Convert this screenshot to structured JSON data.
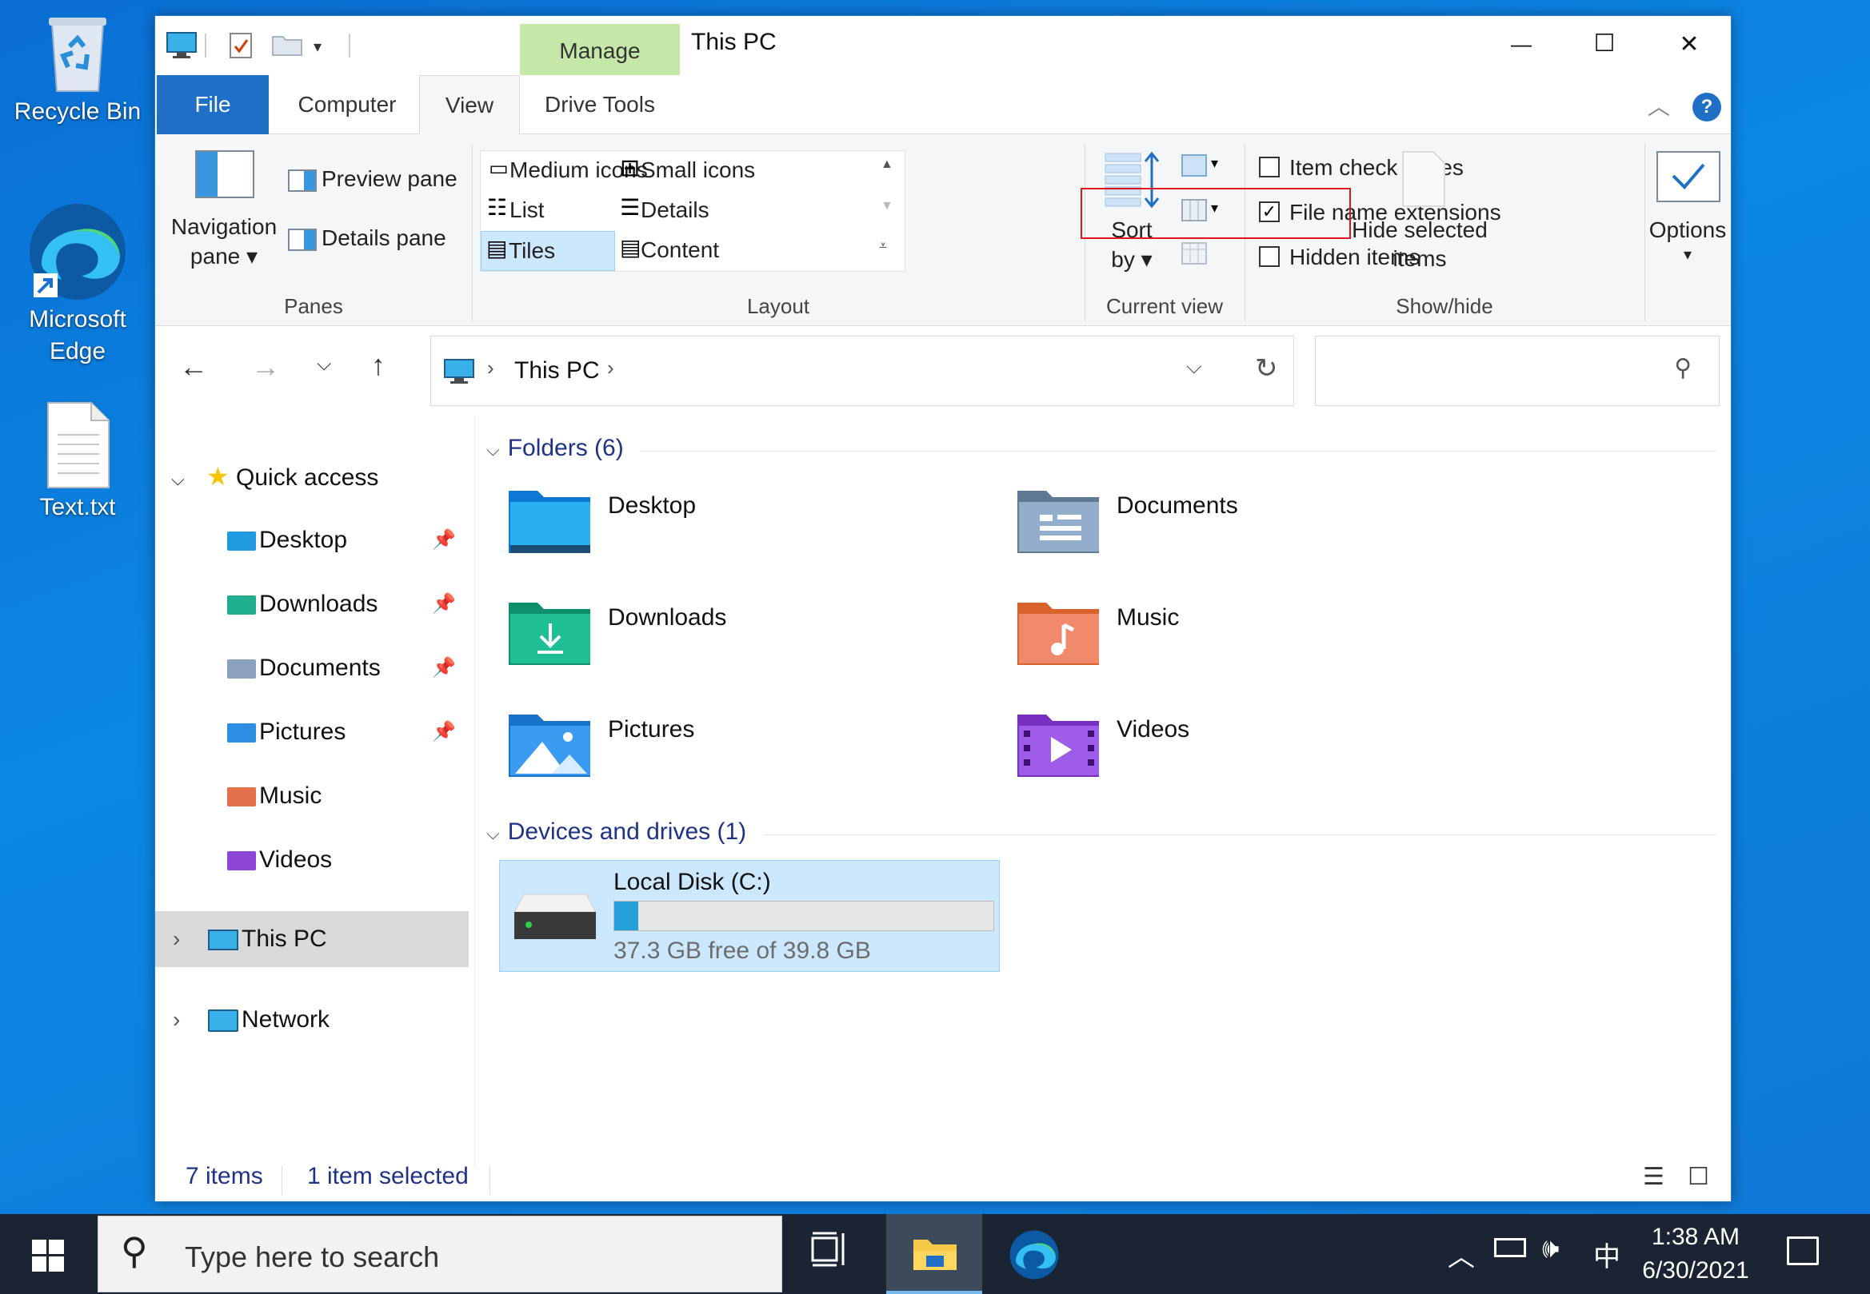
{
  "desktop": {
    "icons": [
      {
        "label": "Recycle Bin"
      },
      {
        "label": "Microsoft Edge"
      },
      {
        "label": "Text.txt"
      }
    ]
  },
  "window": {
    "title": "This PC",
    "context_tab": "Manage",
    "tabs": [
      "File",
      "Computer",
      "View",
      "Drive Tools"
    ],
    "active_tab": "View",
    "controls": {
      "minimize": "—",
      "maximize": "☐",
      "close": "✕"
    }
  },
  "ribbon": {
    "panes": {
      "group": "Panes",
      "navigation_pane": [
        "Navigation",
        "pane"
      ],
      "preview_pane": "Preview pane",
      "details_pane": "Details pane"
    },
    "layout": {
      "group": "Layout",
      "options": [
        "Medium icons",
        "Small icons",
        "List",
        "Details",
        "Tiles",
        "Content"
      ],
      "selected": "Tiles"
    },
    "current_view": {
      "group": "Current view",
      "sort_by": [
        "Sort",
        "by"
      ]
    },
    "show_hide": {
      "group": "Show/hide",
      "item_check_boxes": {
        "label": "Item check boxes",
        "checked": false
      },
      "file_name_extensions": {
        "label": "File name extensions",
        "checked": true
      },
      "hidden_items": {
        "label": "Hidden items",
        "checked": false
      },
      "hide_selected": [
        "Hide selected",
        "items"
      ]
    },
    "options": {
      "label": "Options"
    }
  },
  "address": {
    "location": "This PC",
    "search_placeholder": ""
  },
  "nav_pane": {
    "quick_access": "Quick access",
    "items": [
      {
        "label": "Desktop",
        "pinned": true
      },
      {
        "label": "Downloads",
        "pinned": true
      },
      {
        "label": "Documents",
        "pinned": true
      },
      {
        "label": "Pictures",
        "pinned": true
      },
      {
        "label": "Music",
        "pinned": false
      },
      {
        "label": "Videos",
        "pinned": false
      }
    ],
    "this_pc": "This PC",
    "network": "Network"
  },
  "content": {
    "folders_header": "Folders (6)",
    "folders": [
      "Desktop",
      "Documents",
      "Downloads",
      "Music",
      "Pictures",
      "Videos"
    ],
    "drives_header": "Devices and drives (1)",
    "drive": {
      "name": "Local Disk (C:)",
      "free_text": "37.3 GB free of 39.8 GB",
      "used_fraction": 0.063
    }
  },
  "status": {
    "items": "7 items",
    "selected": "1 item selected"
  },
  "taskbar": {
    "search_placeholder": "Type here to search",
    "time": "1:38 AM",
    "date": "6/30/2021",
    "ime": "中"
  },
  "colors": {
    "accent": "#0063b1",
    "manage_tab": "#c5e8a9",
    "highlight": "#cce8ff",
    "annotation": "#e0141e"
  }
}
